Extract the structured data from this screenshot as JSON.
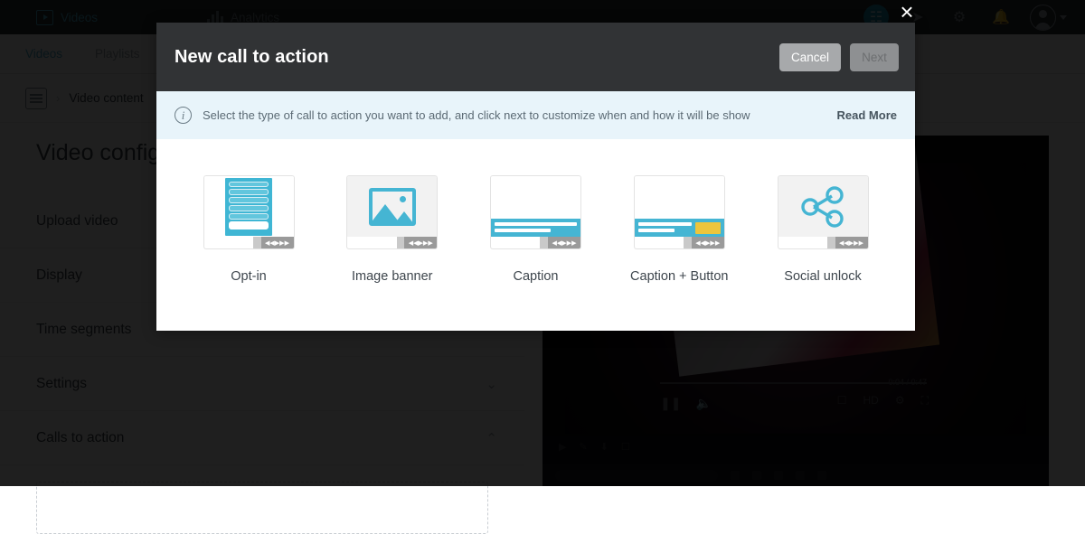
{
  "background": {
    "topnav": {
      "items": [
        {
          "label": "Videos",
          "icon": "video-play-icon"
        },
        {
          "label": "Analytics",
          "icon": "bar-chart-icon"
        }
      ],
      "right_icons": [
        "grid-icon",
        "paper-plane-icon",
        "gear-icon",
        "bell-icon",
        "avatar"
      ]
    },
    "subnav": {
      "tabs": [
        "Videos",
        "Playlists"
      ]
    },
    "breadcrumb": {
      "icon": "document-icon",
      "separator": "›",
      "text": "Video content"
    },
    "page_title": "Video configuration",
    "sidebar_items": [
      {
        "label": "Upload video",
        "chevron": ""
      },
      {
        "label": "Display",
        "chevron": ""
      },
      {
        "label": "Time segments",
        "chevron": ""
      },
      {
        "label": "Settings",
        "chevron": "⌄"
      },
      {
        "label": "Calls to action",
        "chevron": "⌃"
      }
    ],
    "video_player": {
      "time": "0:04 / 0:47",
      "controls_left": [
        "pause-icon",
        "volume-icon"
      ],
      "controls_right": [
        "subtitles-icon",
        "quality-icon",
        "gear-icon",
        "fullscreen-icon"
      ]
    }
  },
  "close_button": {
    "glyph": "×"
  },
  "modal": {
    "title": "New call to action",
    "buttons": {
      "cancel": "Cancel",
      "next": "Next"
    },
    "info": {
      "icon": "info-icon",
      "glyph": "i",
      "text": "Select the type of call to action you want to add, and click next to customize when and how it will be show",
      "link": "Read More"
    },
    "cards": [
      {
        "id": "opt-in",
        "label": "Opt-in"
      },
      {
        "id": "image-banner",
        "label": "Image banner"
      },
      {
        "id": "caption",
        "label": "Caption"
      },
      {
        "id": "caption-button",
        "label": "Caption +\nButton"
      },
      {
        "id": "social-unlock",
        "label": "Social unlock"
      }
    ]
  },
  "colors": {
    "accent_cyan": "#45b5d3",
    "header_dark": "#313335",
    "info_bg": "#e8f4fa",
    "button_yellow": "#edc53c",
    "nav_dark": "#2b3137"
  }
}
